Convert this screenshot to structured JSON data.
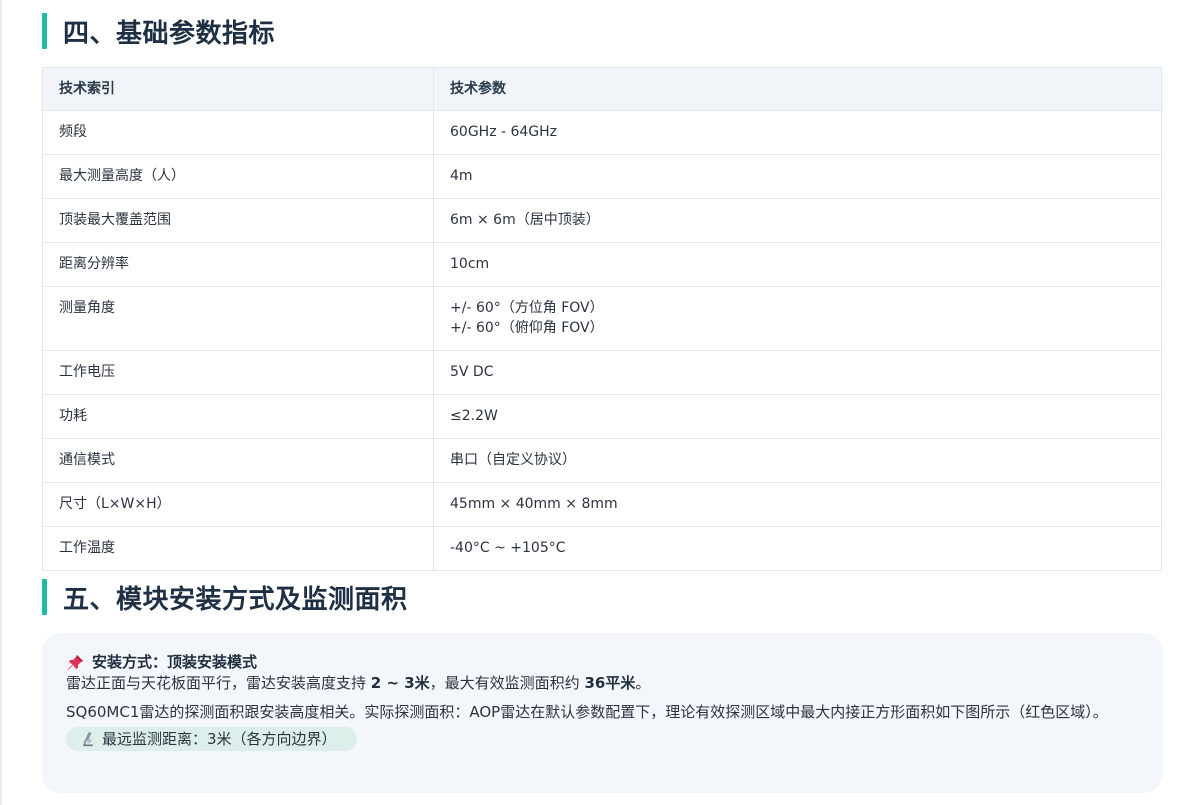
{
  "section4": {
    "title": "四、基础参数指标"
  },
  "spec_table": {
    "headers": [
      "技术索引",
      "技术参数"
    ],
    "rows": [
      {
        "key": "频段",
        "value": [
          "60GHz - 64GHz"
        ]
      },
      {
        "key": "最大测量高度（人）",
        "value": [
          "4m"
        ]
      },
      {
        "key": "顶装最大覆盖范围",
        "value": [
          "6m × 6m（居中顶装）"
        ]
      },
      {
        "key": "距离分辨率",
        "value": [
          "10cm"
        ]
      },
      {
        "key": "测量角度",
        "value": [
          "+/- 60°（方位角 FOV）",
          "+/- 60°（俯仰角 FOV）"
        ]
      },
      {
        "key": "工作电压",
        "value": [
          "5V DC"
        ]
      },
      {
        "key": "功耗",
        "value": [
          "≤2.2W"
        ]
      },
      {
        "key": "通信模式",
        "value": [
          "串口（自定义协议）"
        ]
      },
      {
        "key": "尺寸（L×W×H）",
        "value": [
          "45mm × 40mm × 8mm"
        ]
      },
      {
        "key": "工作温度",
        "value": [
          "-40°C ~ +105°C"
        ]
      }
    ]
  },
  "section5": {
    "title": "五、模块安装方式及监测面积"
  },
  "install_note": {
    "title": "安装方式：顶装安装模式",
    "line1_a": "雷达正面与天花板面平行，雷达安装高度支持 ",
    "line1_b": "2 ~ 3米",
    "line1_c": "，最大有效监测面积约 ",
    "line1_d": "36平米",
    "line1_e": "。",
    "paragraph": "SQ60MC1雷达的探测面积跟安装高度相关。实际探测面积：AOP雷达在默认参数配置下，理论有效探测区域中最大内接正方形面积如下图所示（红色区域）。",
    "pill": "最远监测距离：3米（各方向边界）"
  },
  "icons": {
    "title_icon": "pushpin-icon",
    "pill_icon": "microscope-icon"
  },
  "colors": {
    "accent": "#1fb9a4",
    "pin": "#e0335a",
    "note_bg": "#f3f7fb",
    "pill_bg": "#dcefea"
  }
}
